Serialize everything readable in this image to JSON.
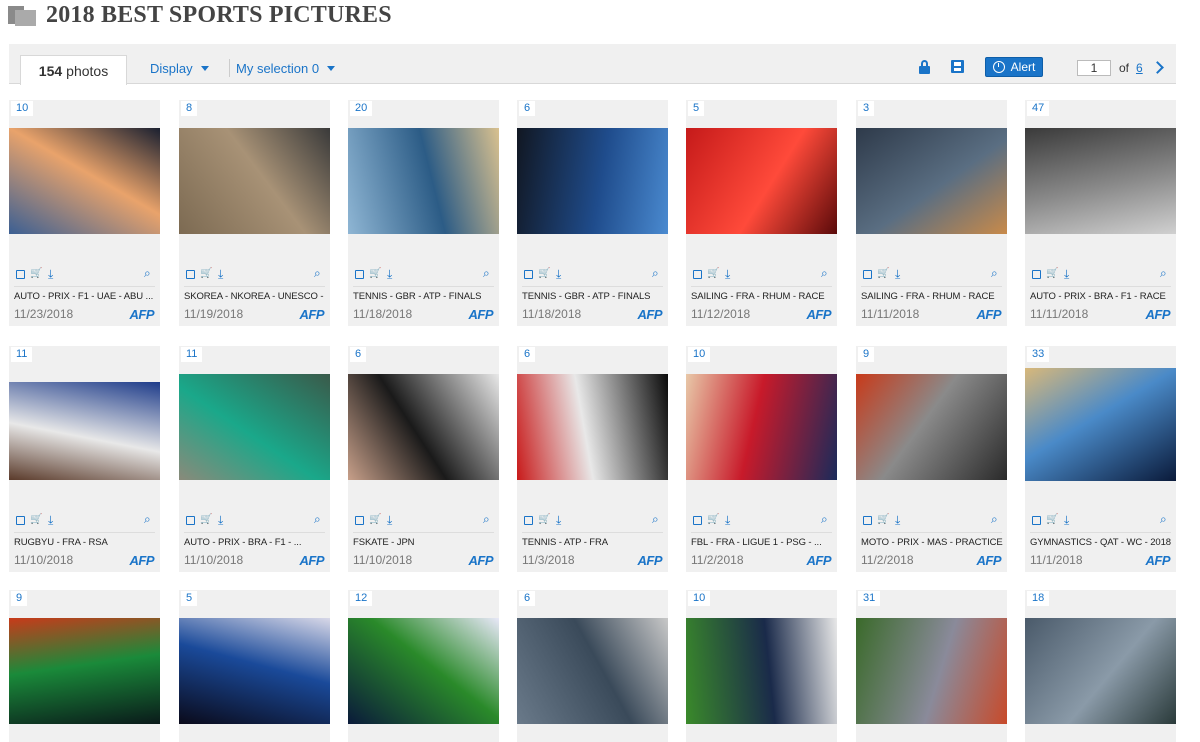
{
  "page": {
    "title": "2018 BEST SPORTS PICTURES",
    "folder_icon": "folder-icon"
  },
  "toolbar": {
    "photo_count": "154",
    "photo_count_label": "photos",
    "display_label": "Display",
    "selection_label": "My selection 0",
    "alert_label": "Alert",
    "current_page": "1",
    "of_label": "of",
    "total_pages": "6",
    "accent_color": "#1a74c8"
  },
  "cards": [
    {
      "count": "10",
      "title": "AUTO - PRIX - F1 - UAE - ABU ...",
      "date": "11/23/2018",
      "source": "AFP",
      "colors": [
        "#3b5f93",
        "#e9a36b",
        "#1a2030"
      ]
    },
    {
      "count": "8",
      "title": "SKOREA - NKOREA - UNESCO - ...",
      "date": "11/19/2018",
      "source": "AFP",
      "colors": [
        "#7c6a52",
        "#a89276",
        "#3a3a3a"
      ]
    },
    {
      "count": "20",
      "title": "TENNIS - GBR - ATP - FINALS",
      "date": "11/18/2018",
      "source": "AFP",
      "colors": [
        "#8fb6d4",
        "#2c5c86",
        "#d9c18f"
      ]
    },
    {
      "count": "6",
      "title": "TENNIS - GBR - ATP - FINALS",
      "date": "11/18/2018",
      "source": "AFP",
      "colors": [
        "#111722",
        "#1f4c8c",
        "#4a8ad0"
      ]
    },
    {
      "count": "5",
      "title": "SAILING - FRA - RHUM - RACE",
      "date": "11/12/2018",
      "source": "AFP",
      "colors": [
        "#c51a1a",
        "#ff4a3a",
        "#5a0a0a"
      ]
    },
    {
      "count": "3",
      "title": "SAILING - FRA - RHUM - RACE",
      "date": "11/11/2018",
      "source": "AFP",
      "colors": [
        "#2e3a4a",
        "#5a6e82",
        "#c88a4a"
      ]
    },
    {
      "count": "47",
      "title": "AUTO - PRIX - BRA - F1 - RACE",
      "date": "11/11/2018",
      "source": "AFP",
      "colors": [
        "#3a3a3a",
        "#8a8a8a",
        "#d0d0d0"
      ]
    },
    {
      "count": "11",
      "title": "RUGBYU - FRA - RSA",
      "date": "11/10/2018",
      "source": "AFP",
      "colors": [
        "#1e3c8a",
        "#e8e8e8",
        "#5a3a2a"
      ]
    },
    {
      "count": "11",
      "title": "AUTO - PRIX - BRA - F1 - ...",
      "date": "11/10/2018",
      "source": "AFP",
      "colors": [
        "#3a5a4a",
        "#1aa88a",
        "#8a8a7a"
      ]
    },
    {
      "count": "6",
      "title": "FSKATE - JPN",
      "date": "11/10/2018",
      "source": "AFP",
      "colors": [
        "#e8e8e8",
        "#1a1a1a",
        "#c8a08a"
      ]
    },
    {
      "count": "6",
      "title": "TENNIS - ATP - FRA",
      "date": "11/3/2018",
      "source": "AFP",
      "colors": [
        "#0a0a0a",
        "#e8e8e8",
        "#c81a1a"
      ]
    },
    {
      "count": "10",
      "title": "FBL - FRA - LIGUE 1 - PSG - ...",
      "date": "11/2/2018",
      "source": "AFP",
      "colors": [
        "#1a2a5a",
        "#c81a2a",
        "#e8c8a8"
      ]
    },
    {
      "count": "9",
      "title": "MOTO - PRIX - MAS - PRACTICE",
      "date": "11/2/2018",
      "source": "AFP",
      "colors": [
        "#2a2a2a",
        "#8a8a8a",
        "#c83a1a"
      ]
    },
    {
      "count": "33",
      "title": "GYMNASTICS - QAT - WC - 2018",
      "date": "11/1/2018",
      "source": "AFP",
      "colors": [
        "#0a1a3a",
        "#4a8ac8",
        "#d8b87a"
      ]
    },
    {
      "count": "9",
      "title": "",
      "date": "",
      "source": "",
      "colors": [
        "#0a1a1a",
        "#1a8a3a",
        "#c83a1a"
      ]
    },
    {
      "count": "5",
      "title": "",
      "date": "",
      "source": "",
      "colors": [
        "#0a0a1a",
        "#1a4a9a",
        "#d8d8e8"
      ]
    },
    {
      "count": "12",
      "title": "",
      "date": "",
      "source": "",
      "colors": [
        "#0a1a3a",
        "#2a8a2a",
        "#e8e8f8"
      ]
    },
    {
      "count": "6",
      "title": "",
      "date": "",
      "source": "",
      "colors": [
        "#6a7a8a",
        "#3a4a5a",
        "#c8c8c8"
      ]
    },
    {
      "count": "10",
      "title": "",
      "date": "",
      "source": "",
      "colors": [
        "#3a8a2a",
        "#1a2a4a",
        "#e8e8e8"
      ]
    },
    {
      "count": "31",
      "title": "",
      "date": "",
      "source": "",
      "colors": [
        "#3a6a2a",
        "#8a8a9a",
        "#c84a2a"
      ]
    },
    {
      "count": "18",
      "title": "",
      "date": "",
      "source": "",
      "colors": [
        "#4a5a6a",
        "#8a9aa8",
        "#2a3a3a"
      ]
    }
  ]
}
